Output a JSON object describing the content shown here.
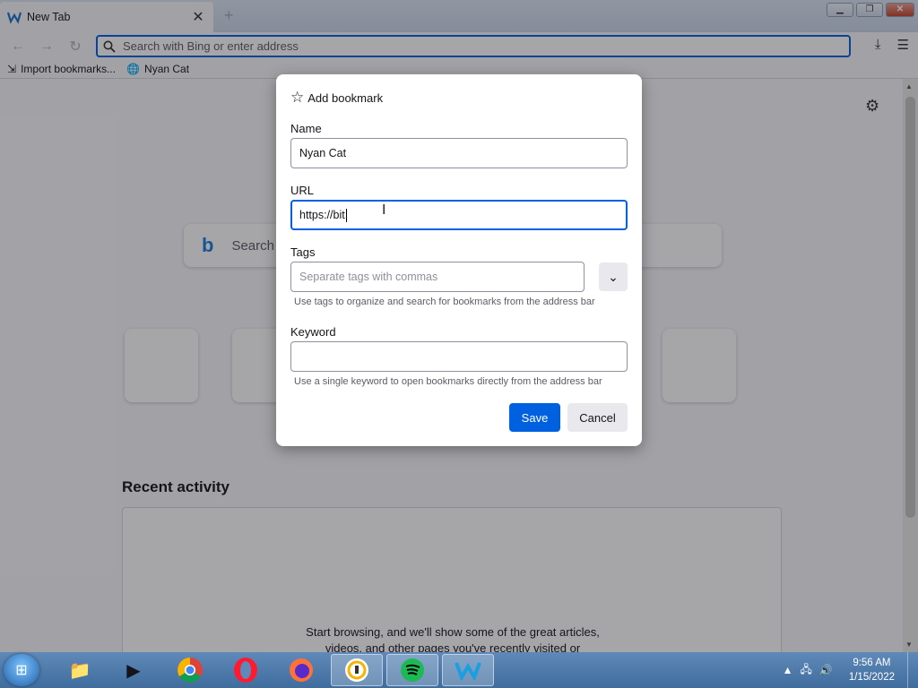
{
  "browser": {
    "tab_title": "New Tab",
    "url_placeholder": "Search with Bing or enter address",
    "bookmarks": [
      {
        "label": "Import bookmarks..."
      },
      {
        "label": "Nyan Cat"
      }
    ]
  },
  "newtab": {
    "search_placeholder": "Search w",
    "recent_activity_title": "Recent activity",
    "recent_activity_message_line1": "Start browsing, and we'll show some of the great articles,",
    "recent_activity_message_line2": "videos, and other pages you've recently visited or"
  },
  "dialog": {
    "title": "Add bookmark",
    "name_label": "Name",
    "name_value": "Nyan Cat",
    "url_label": "URL",
    "url_value": "https://bit",
    "tags_label": "Tags",
    "tags_placeholder": "Separate tags with commas",
    "tags_hint": "Use tags to organize and search for bookmarks from the address bar",
    "keyword_label": "Keyword",
    "keyword_value": "",
    "keyword_hint": "Use a single keyword to open bookmarks directly from the address bar",
    "save_label": "Save",
    "cancel_label": "Cancel"
  },
  "taskbar": {
    "time": "9:56 AM",
    "date": "1/15/2022"
  },
  "colors": {
    "accent": "#0061e0",
    "taskbar": "#4a78a8"
  }
}
